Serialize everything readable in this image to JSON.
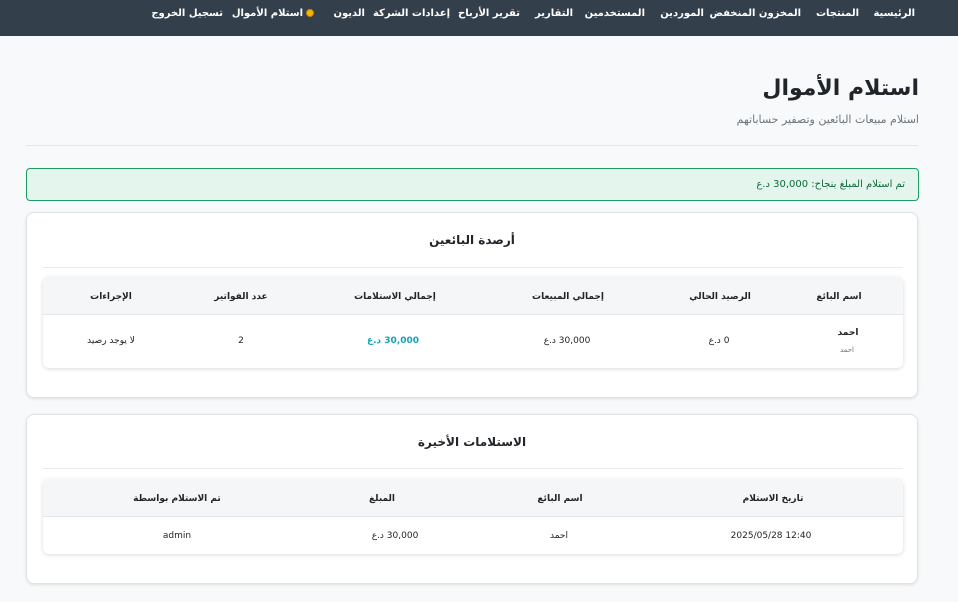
{
  "nav": {
    "home": "الرئيسية",
    "products": "المنتجات",
    "low_stock": "المخزون المنخفض",
    "suppliers": "الموردين",
    "users": "المستخدمين",
    "reports": "التقارير",
    "profit_report": "تقرير الأرباح",
    "company_settings": "إعدادات الشركة",
    "debts": "الديون",
    "receive_money": "استلام الأموال",
    "receive_money_icon": "money-bag-icon",
    "logout": "تسجيل الخروج"
  },
  "page": {
    "title": "استلام الأموال",
    "subtitle": "استلام مبيعات البائعين وتصفير حساباتهم"
  },
  "alert": {
    "message": "تم استلام المبلغ بنجاح: 30,000 د.ع",
    "color": "#1e9c63"
  },
  "balances": {
    "title": "أرصدة البائعين",
    "headers": {
      "seller_name": "اسم البائع",
      "current_balance": "الرصيد الحالي",
      "total_sales": "إجمالي المبيعات",
      "total_receipts": "إجمالي الاستلامات",
      "invoice_count": "عدد الفواتير",
      "actions": "الإجراءات"
    },
    "rows": [
      {
        "seller_name": "احمد",
        "seller_username": "احمد",
        "current_balance": "0 د.ع",
        "total_sales": "30,000 د.ع",
        "total_receipts": "30,000 د.ع",
        "invoice_count": "2",
        "actions": "لا يوجد رصيد"
      }
    ]
  },
  "recent": {
    "title": "الاستلامات الأخيرة",
    "headers": {
      "date": "تاريخ الاستلام",
      "seller_name": "اسم البائع",
      "amount": "المبلغ",
      "received_by": "تم الاستلام بواسطة"
    },
    "rows": [
      {
        "date": "2025/05/28 12:40",
        "seller_name": "احمد",
        "amount": "30,000 د.ع",
        "received_by": "admin"
      }
    ]
  },
  "colors": {
    "navbar": "#343f4c",
    "accent_teal": "#17a2b8",
    "success": "#1e9c63"
  }
}
